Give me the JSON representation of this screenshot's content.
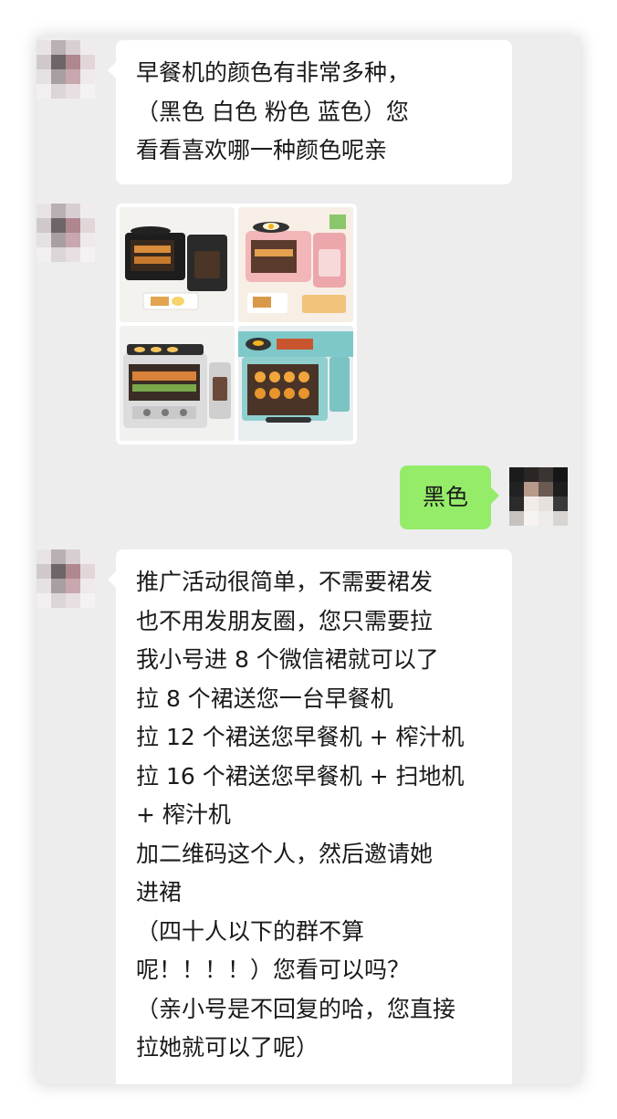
{
  "messages": [
    {
      "side": "left",
      "text": "早餐机的颜色有非常多种，\n（黑色  白色   粉色  蓝色）您\n看看喜欢哪一种颜色呢亲"
    },
    {
      "side": "left",
      "type": "image",
      "image_desc": "早餐机"
    },
    {
      "side": "right",
      "text": "黑色"
    },
    {
      "side": "left",
      "text": "推广活动很简单，不需要裙发\n也不用发朋友圈，您只需要拉\n我小号进 8 个微信裙就可以了\n拉 8 个裙送您一台早餐机\n拉 12 个裙送您早餐机 + 榨汁机\n拉 16 个裙送您早餐机 + 扫地机\n+ 榨汁机\n加二维码这个人，然后邀请她\n进裙\n（四十人以下的群不算\n呢！！！！）您看可以吗？\n（亲小号是不回复的哈，您直接\n拉她就可以了呢）"
    }
  ],
  "colors": {
    "chat_background": "#ededed",
    "received_bubble": "#ffffff",
    "sent_bubble": "#95ec69"
  },
  "icons": {
    "contact_avatar": "pixelated-avatar-icon",
    "own_avatar": "pixelated-avatar-icon"
  }
}
